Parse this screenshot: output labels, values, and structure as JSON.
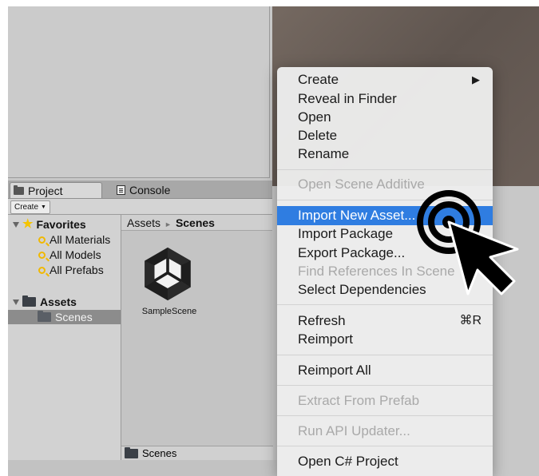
{
  "tabs": {
    "project": "Project",
    "console": "Console"
  },
  "toolbar": {
    "create_label": "Create"
  },
  "tree": {
    "favorites": "Favorites",
    "favorites_items": [
      "All Materials",
      "All Models",
      "All Prefabs"
    ],
    "assets": "Assets",
    "scenes": "Scenes"
  },
  "content": {
    "breadcrumb_root": "Assets",
    "breadcrumb_current": "Scenes",
    "asset_name": "SampleScene"
  },
  "status": {
    "folder": "Scenes"
  },
  "menu": {
    "create": "Create",
    "reveal": "Reveal in Finder",
    "open": "Open",
    "delete": "Delete",
    "rename": "Rename",
    "open_scene_additive": "Open Scene Additive",
    "import_new_asset": "Import New Asset...",
    "import_package": "Import Package",
    "export_package": "Export Package...",
    "find_references": "Find References In Scene",
    "select_dependencies": "Select Dependencies",
    "refresh": "Refresh",
    "refresh_shortcut": "⌘R",
    "reimport": "Reimport",
    "reimport_all": "Reimport All",
    "extract_from_prefab": "Extract From Prefab",
    "run_api_updater": "Run API Updater...",
    "open_csharp_project": "Open C# Project"
  },
  "colors": {
    "highlight": "#2f7de1",
    "favorites_star": "#f5c400",
    "selected_row": "#8c8c8c"
  }
}
